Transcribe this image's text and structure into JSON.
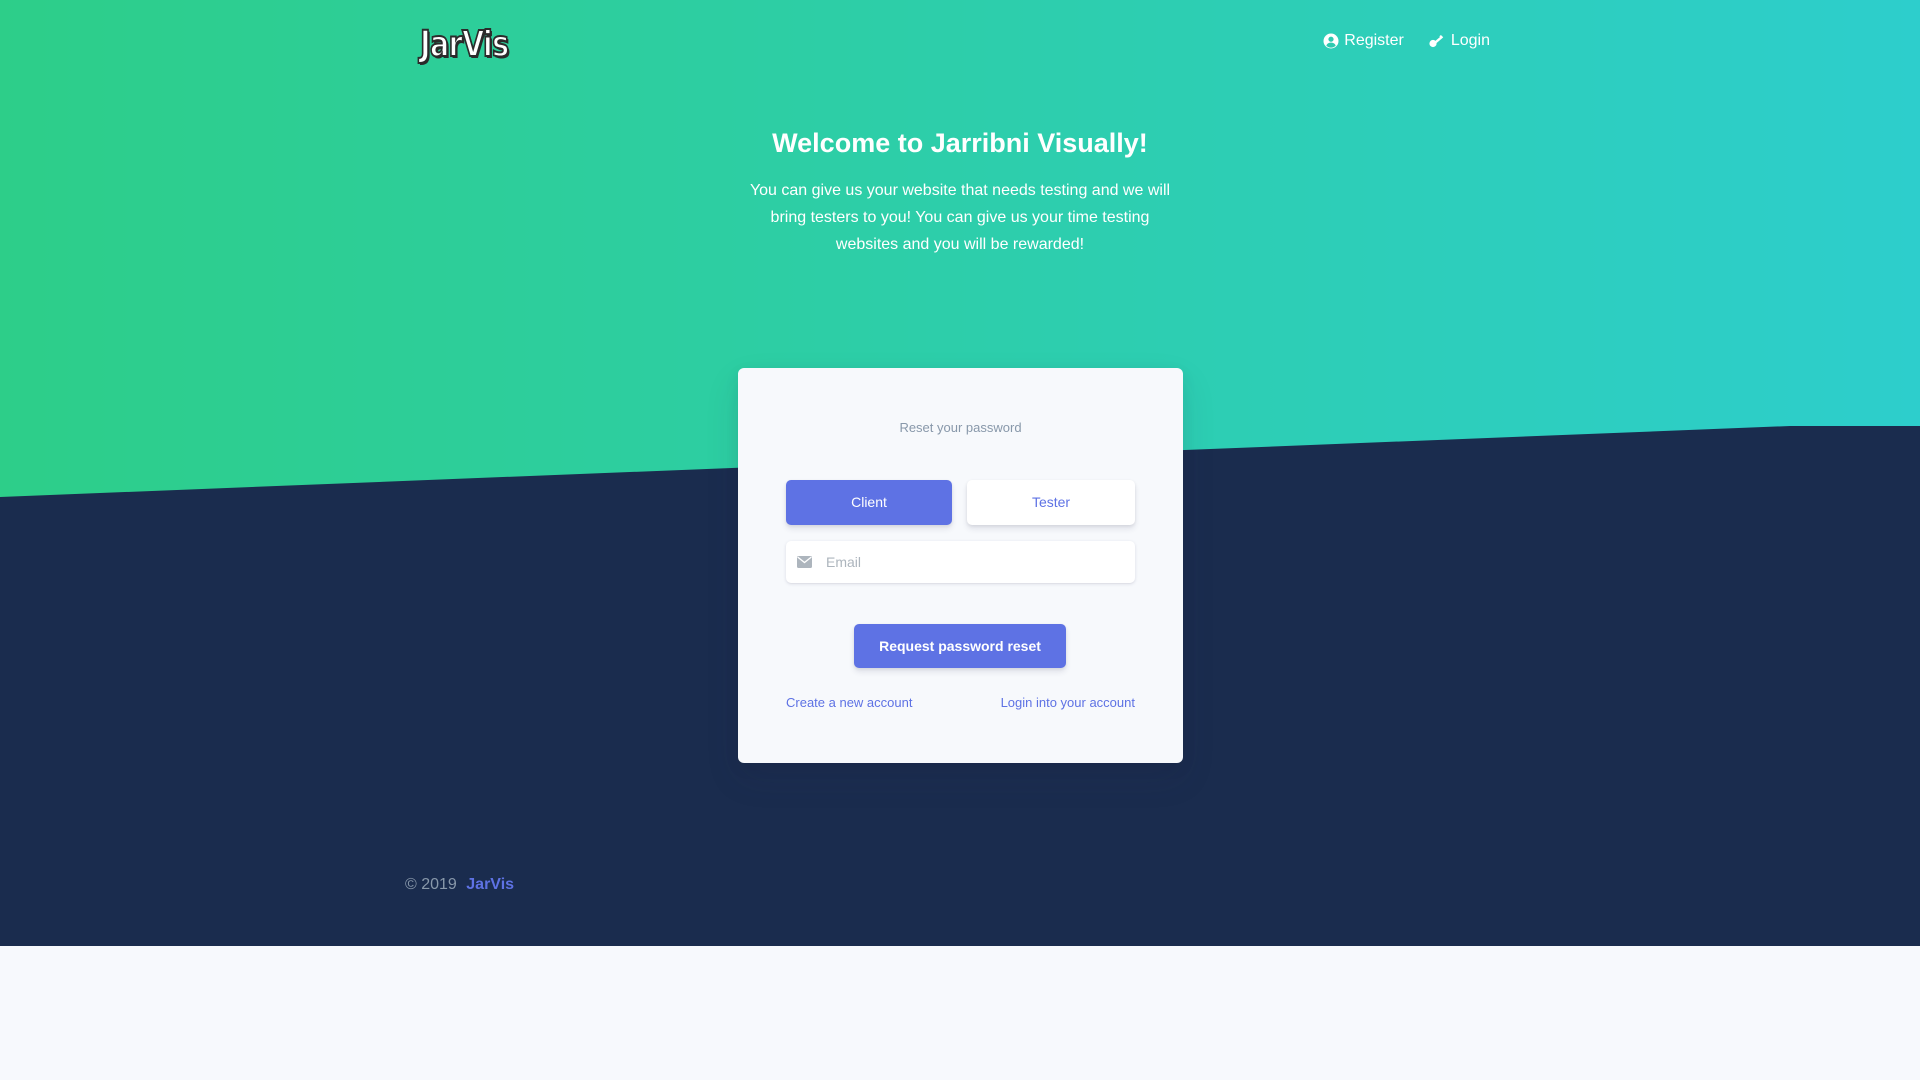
{
  "brand": {
    "logo_text": "JarVis"
  },
  "nav": {
    "register_label": "Register",
    "login_label": "Login"
  },
  "hero": {
    "title": "Welcome to Jarribni Visually!",
    "description": "You can give us your website that needs testing and we will bring testers to you! You can give us your time testing websites and you will be rewarded!"
  },
  "reset_form": {
    "heading": "Reset your password",
    "role_client_label": "Client",
    "role_tester_label": "Tester",
    "selected_role": "Client",
    "email_placeholder": "Email",
    "email_value": "",
    "submit_label": "Request password reset",
    "create_account_link": "Create a new account",
    "login_link": "Login into your account"
  },
  "footer": {
    "copyright": "© 2019",
    "brand_link": "JarVis"
  },
  "colors": {
    "gradient_start": "#2dce89",
    "gradient_end": "#2dcecc",
    "dark_background": "#1a2c4e",
    "primary": "#5e72e4",
    "page_background": "#f7f9fd"
  },
  "icons": {
    "register": "user-circle-icon",
    "login": "key-icon",
    "email": "envelope-icon"
  }
}
